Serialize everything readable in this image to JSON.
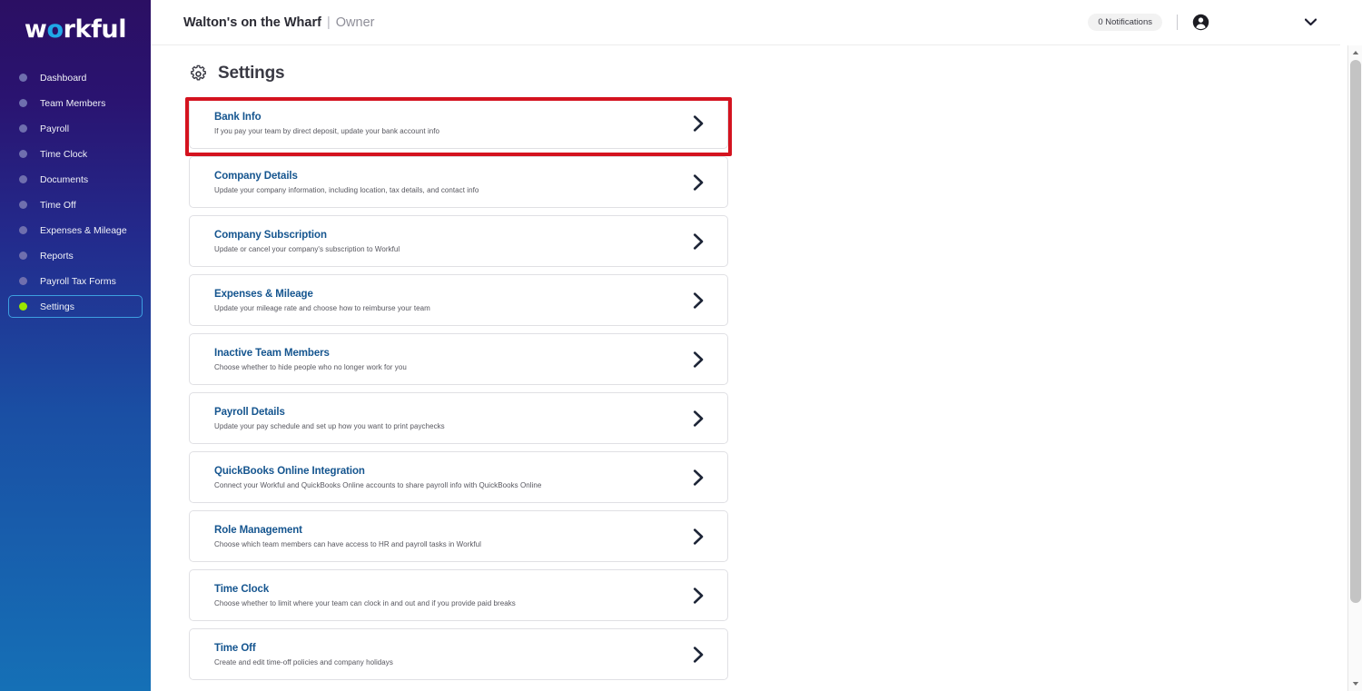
{
  "brand": {
    "logo_prefix": "w",
    "logo_accent": "o",
    "logo_suffix": "rkful",
    "accent_color": "#1fa8e8"
  },
  "sidebar": {
    "items": [
      {
        "label": "Dashboard",
        "active": false
      },
      {
        "label": "Team Members",
        "active": false
      },
      {
        "label": "Payroll",
        "active": false
      },
      {
        "label": "Time Clock",
        "active": false
      },
      {
        "label": "Documents",
        "active": false
      },
      {
        "label": "Time Off",
        "active": false
      },
      {
        "label": "Expenses & Mileage",
        "active": false
      },
      {
        "label": "Reports",
        "active": false
      },
      {
        "label": "Payroll Tax Forms",
        "active": false
      },
      {
        "label": "Settings",
        "active": true
      }
    ],
    "active_dot_color": "#9ae600",
    "dot_color": "#6f6fae"
  },
  "header": {
    "company_name": "Walton's on the Wharf",
    "separator": "|",
    "role": "Owner",
    "notifications": "0 Notifications",
    "avatar_icon": "account-circle-icon",
    "chevron_icon": "chevron-down-icon"
  },
  "main": {
    "page_icon": "gear-icon",
    "page_title": "Settings",
    "highlight_color": "#d4131f",
    "cards": [
      {
        "title": "Bank Info",
        "desc": "If you pay your team by direct deposit, update your bank account info",
        "highlighted": true
      },
      {
        "title": "Company Details",
        "desc": "Update your company information, including location, tax details, and contact info",
        "highlighted": false
      },
      {
        "title": "Company Subscription",
        "desc": "Update or cancel your company's subscription to Workful",
        "highlighted": false
      },
      {
        "title": "Expenses & Mileage",
        "desc": "Update your mileage rate and choose how to reimburse your team",
        "highlighted": false
      },
      {
        "title": "Inactive Team Members",
        "desc": "Choose whether to hide people who no longer work for you",
        "highlighted": false
      },
      {
        "title": "Payroll Details",
        "desc": "Update your pay schedule and set up how you want to print paychecks",
        "highlighted": false
      },
      {
        "title": "QuickBooks Online Integration",
        "desc": "Connect your Workful and QuickBooks Online accounts to share payroll info with QuickBooks Online",
        "highlighted": false
      },
      {
        "title": "Role Management",
        "desc": "Choose which team members can have access to HR and payroll tasks in Workful",
        "highlighted": false
      },
      {
        "title": "Time Clock",
        "desc": "Choose whether to limit where your team can clock in and out and if you provide paid breaks",
        "highlighted": false
      },
      {
        "title": "Time Off",
        "desc": "Create and edit time-off policies and company holidays",
        "highlighted": false
      }
    ],
    "card_chevron_icon": "chevron-right-icon"
  },
  "scrollbar": {
    "up_icon": "scroll-up-arrow-icon",
    "down_icon": "scroll-down-arrow-icon",
    "thumb": "scrollbar-thumb"
  }
}
